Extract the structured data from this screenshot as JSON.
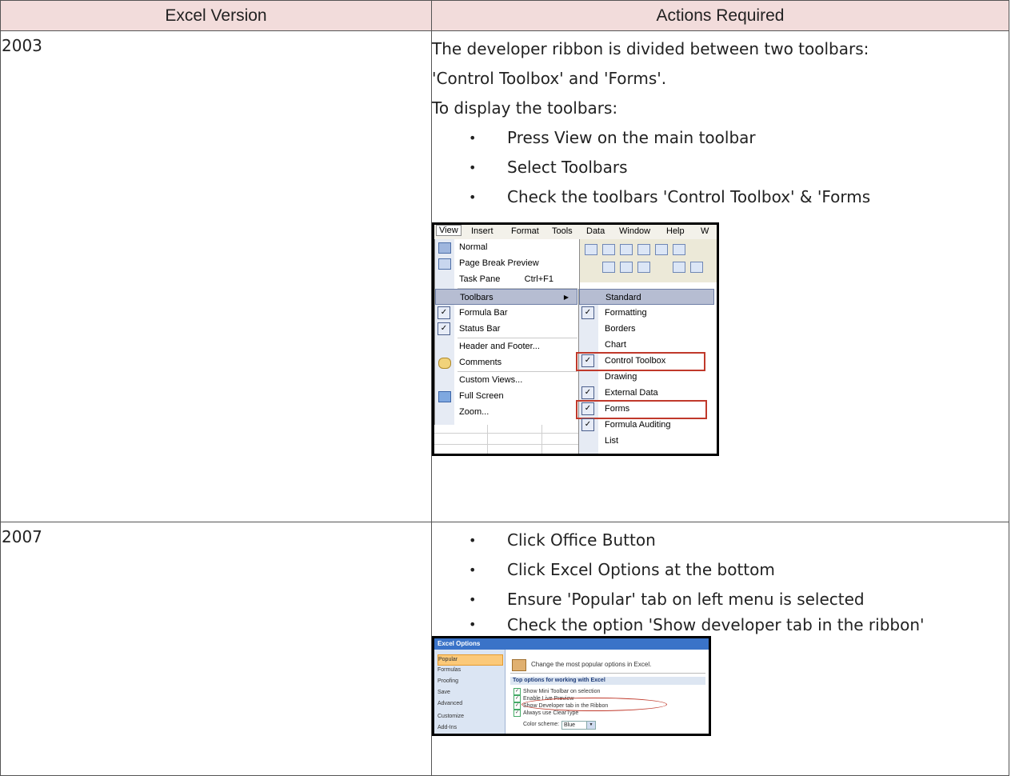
{
  "table": {
    "headers": [
      "Excel Version",
      "Actions Required"
    ],
    "header_bg": "#f2dcdb"
  },
  "row2003": {
    "version": "2003",
    "para1_line1": "The developer ribbon is divided between two toolbars:",
    "para1_line2": "'Control Toolbox' and 'Forms'.",
    "para2": "To display the toolbars:",
    "bullets": [
      "Press View on the main toolbar",
      "Select Toolbars",
      "Check the toolbars 'Control Toolbox' & 'Forms"
    ],
    "screenshot": {
      "menubar": [
        "View",
        "Insert",
        "Format",
        "Tools",
        "Data",
        "Window",
        "Help",
        "W"
      ],
      "view_menu": [
        {
          "label": "Normal",
          "shortcut": ""
        },
        {
          "label": "Page Break Preview",
          "shortcut": ""
        },
        {
          "label": "Task Pane",
          "shortcut": "Ctrl+F1"
        },
        {
          "label": "Toolbars",
          "shortcut": ""
        },
        {
          "label": "Formula Bar",
          "shortcut": ""
        },
        {
          "label": "Status Bar",
          "shortcut": ""
        },
        {
          "label": "Header and Footer...",
          "shortcut": ""
        },
        {
          "label": "Comments",
          "shortcut": ""
        },
        {
          "label": "Custom Views...",
          "shortcut": ""
        },
        {
          "label": "Full Screen",
          "shortcut": ""
        },
        {
          "label": "Zoom...",
          "shortcut": ""
        }
      ],
      "toolbars_menu": [
        {
          "label": "Standard",
          "checked": false
        },
        {
          "label": "Formatting",
          "checked": true
        },
        {
          "label": "Borders",
          "checked": false
        },
        {
          "label": "Chart",
          "checked": false
        },
        {
          "label": "Control Toolbox",
          "checked": true
        },
        {
          "label": "Drawing",
          "checked": false
        },
        {
          "label": "External Data",
          "checked": true
        },
        {
          "label": "Forms",
          "checked": true
        },
        {
          "label": "Formula Auditing",
          "checked": true
        },
        {
          "label": "List",
          "checked": false
        }
      ],
      "highlight_color": "#c0392b"
    }
  },
  "row2007": {
    "version": "2007",
    "bullets": [
      "Click Office Button",
      "Click Excel Options at the bottom",
      "Ensure 'Popular' tab on left menu is selected",
      "Check the option 'Show developer tab in the ribbon'"
    ],
    "screenshot": {
      "title": "Excel Options",
      "left_menu": [
        "Popular",
        "Formulas",
        "Proofing",
        "Save",
        "Advanced",
        "Customize",
        "Add-Ins"
      ],
      "header": "Change the most popular options in Excel.",
      "section": "Top options for working with Excel",
      "options": [
        "Show Mini Toolbar on selection",
        "Enable Live Preview",
        "Show Developer tab in the Ribbon",
        "Always use ClearType"
      ],
      "color_scheme_label": "Color scheme:",
      "color_scheme_value": "Blue"
    }
  }
}
